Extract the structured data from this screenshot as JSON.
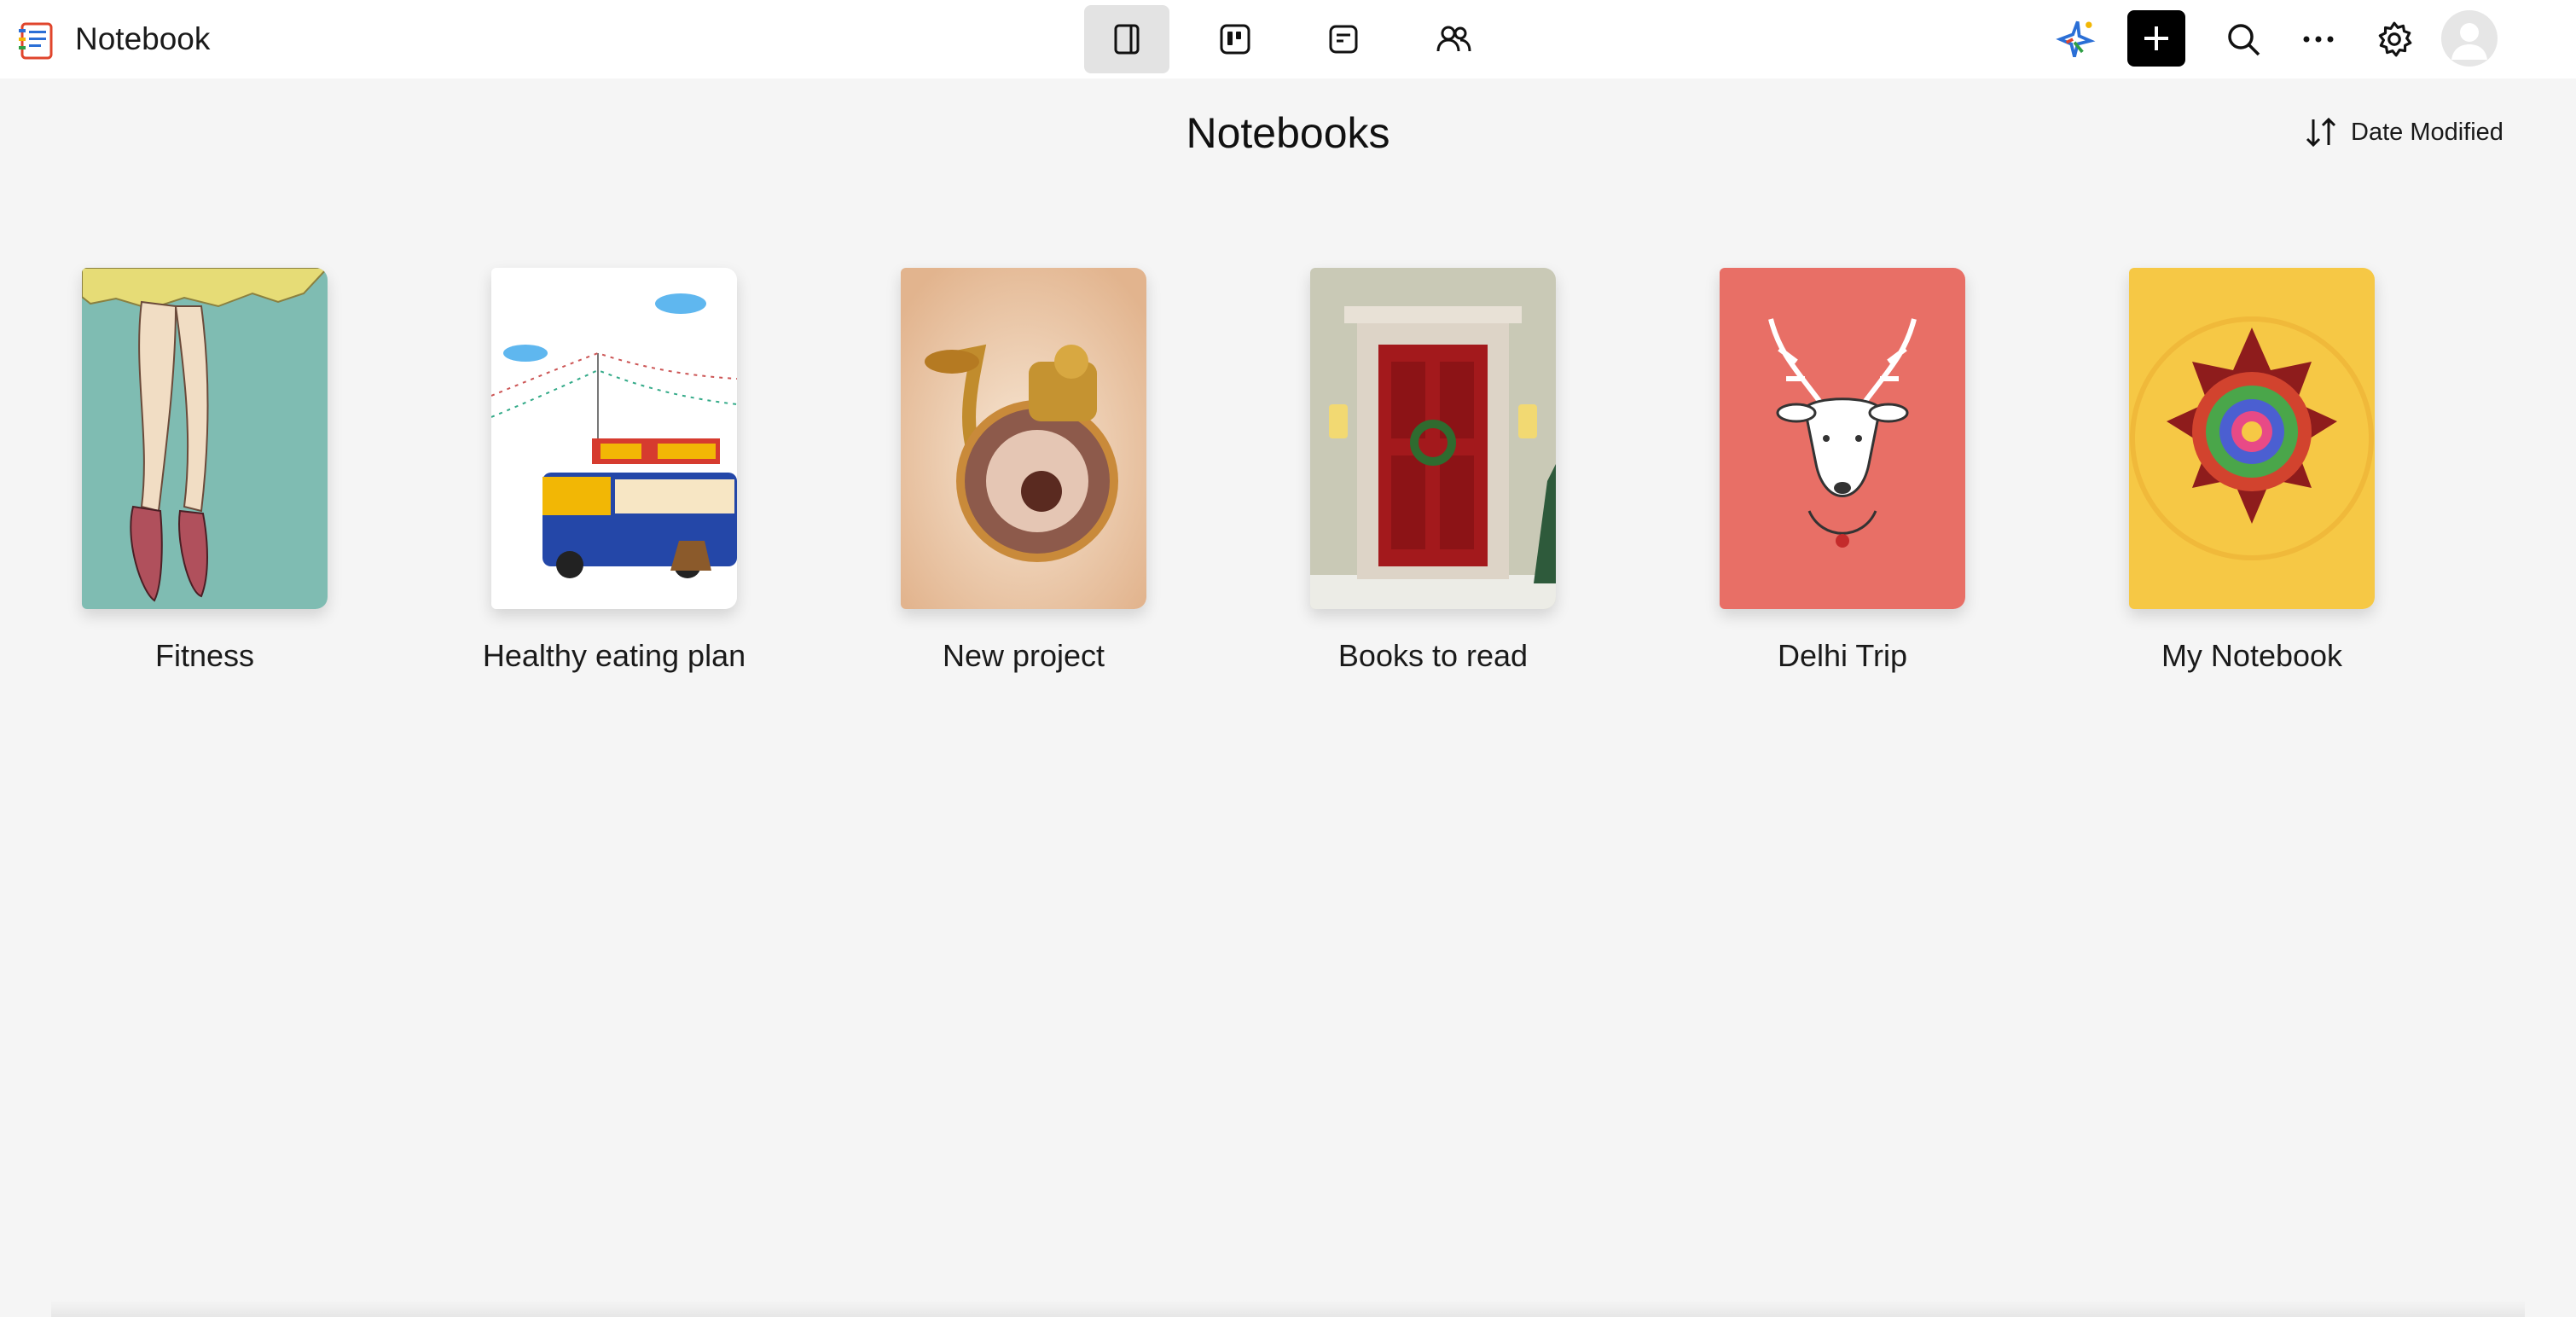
{
  "app": {
    "title": "Notebook",
    "logo_icon": "notebook-logo-icon"
  },
  "header": {
    "view_buttons": [
      {
        "name": "notebooks-view",
        "icon": "panel-icon",
        "active": true
      },
      {
        "name": "board-view",
        "icon": "board-icon",
        "active": false
      },
      {
        "name": "cards-view",
        "icon": "card-icon",
        "active": false
      },
      {
        "name": "shared-view",
        "icon": "people-icon",
        "active": false
      }
    ],
    "right_icons": [
      "ai-sparkle-icon",
      "plus-icon",
      "search-icon",
      "more-icon",
      "gear-icon",
      "avatar-icon"
    ]
  },
  "main": {
    "title": "Notebooks",
    "sort_label": "Date Modified",
    "notebooks": [
      {
        "label": "Fitness",
        "cover_color": "#7fbcb2"
      },
      {
        "label": "Healthy eating plan",
        "cover_color": "#ffffff"
      },
      {
        "label": "New project",
        "cover_color": "#ecd3bb"
      },
      {
        "label": "Books to read",
        "cover_color": "#c9c9b6"
      },
      {
        "label": "Delhi Trip",
        "cover_color": "#e86f66"
      },
      {
        "label": "My Notebook",
        "cover_color": "#f6c845"
      }
    ]
  },
  "colors": {
    "background": "#f5f5f5",
    "topbar": "#ffffff",
    "accent": "#000000"
  }
}
